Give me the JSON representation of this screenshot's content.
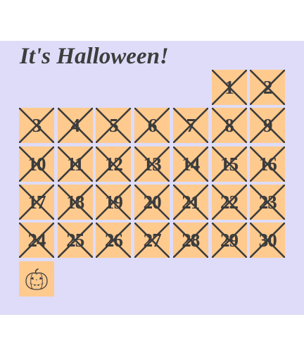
{
  "title": "It's Halloween!",
  "colors": {
    "background": "#dedcf8",
    "cell": "#ffca8e",
    "ink": "#3c3c3c"
  },
  "calendar": {
    "start_weekday_index": 5,
    "days": [
      {
        "label": "1",
        "crossed": true
      },
      {
        "label": "2",
        "crossed": true
      },
      {
        "label": "3",
        "crossed": true
      },
      {
        "label": "4",
        "crossed": true
      },
      {
        "label": "5",
        "crossed": true
      },
      {
        "label": "6",
        "crossed": true
      },
      {
        "label": "7",
        "crossed": true
      },
      {
        "label": "8",
        "crossed": true
      },
      {
        "label": "9",
        "crossed": true
      },
      {
        "label": "10",
        "crossed": true
      },
      {
        "label": "11",
        "crossed": true
      },
      {
        "label": "12",
        "crossed": true
      },
      {
        "label": "13",
        "crossed": true
      },
      {
        "label": "14",
        "crossed": true
      },
      {
        "label": "15",
        "crossed": true
      },
      {
        "label": "16",
        "crossed": true
      },
      {
        "label": "17",
        "crossed": true
      },
      {
        "label": "18",
        "crossed": true
      },
      {
        "label": "19",
        "crossed": true
      },
      {
        "label": "20",
        "crossed": true
      },
      {
        "label": "21",
        "crossed": true
      },
      {
        "label": "22",
        "crossed": true
      },
      {
        "label": "23",
        "crossed": true
      },
      {
        "label": "24",
        "crossed": true
      },
      {
        "label": "25",
        "crossed": true
      },
      {
        "label": "26",
        "crossed": true
      },
      {
        "label": "27",
        "crossed": true
      },
      {
        "label": "28",
        "crossed": true
      },
      {
        "label": "29",
        "crossed": true
      },
      {
        "label": "30",
        "crossed": true
      }
    ],
    "final_day": {
      "icon": "jack-o-lantern-icon",
      "crossed": false
    }
  }
}
